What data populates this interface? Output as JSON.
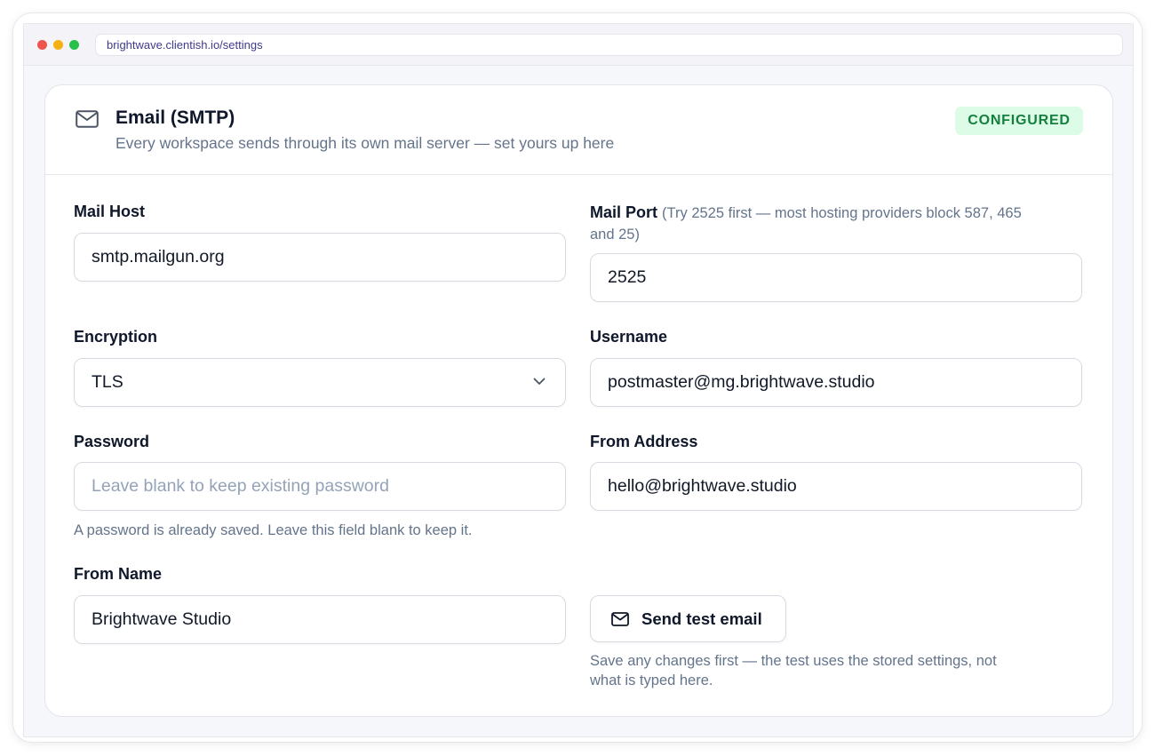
{
  "browser": {
    "url": "brightwave.clientish.io/settings"
  },
  "header": {
    "icon": "mail-icon",
    "title": "Email (SMTP)",
    "subtitle": "Every workspace sends through its own mail server — set yours up here",
    "status_badge": "CONFIGURED",
    "status_color": "#15803d"
  },
  "form": {
    "mail_host": {
      "label": "Mail Host",
      "value": "smtp.mailgun.org"
    },
    "mail_port": {
      "label": "Mail Port",
      "hint_line1": "(Try 2525 first — most hosting providers block 587, 465",
      "hint_line2": "and 25)",
      "value": "2525"
    },
    "encryption": {
      "label": "Encryption",
      "value": "TLS"
    },
    "username": {
      "label": "Username",
      "value": "postmaster@mg.brightwave.studio"
    },
    "password": {
      "label": "Password",
      "placeholder": "Leave blank to keep existing password",
      "help": "A password is already saved. Leave this field blank to keep it."
    },
    "from_address": {
      "label": "From Address",
      "value": "hello@brightwave.studio"
    },
    "from_name": {
      "label": "From Name",
      "value": "Brightwave Studio"
    }
  },
  "test_email": {
    "button_label": "Send test email",
    "help_line1": "Save any changes first — the test uses the stored settings, not",
    "help_line2": "what is typed here."
  }
}
